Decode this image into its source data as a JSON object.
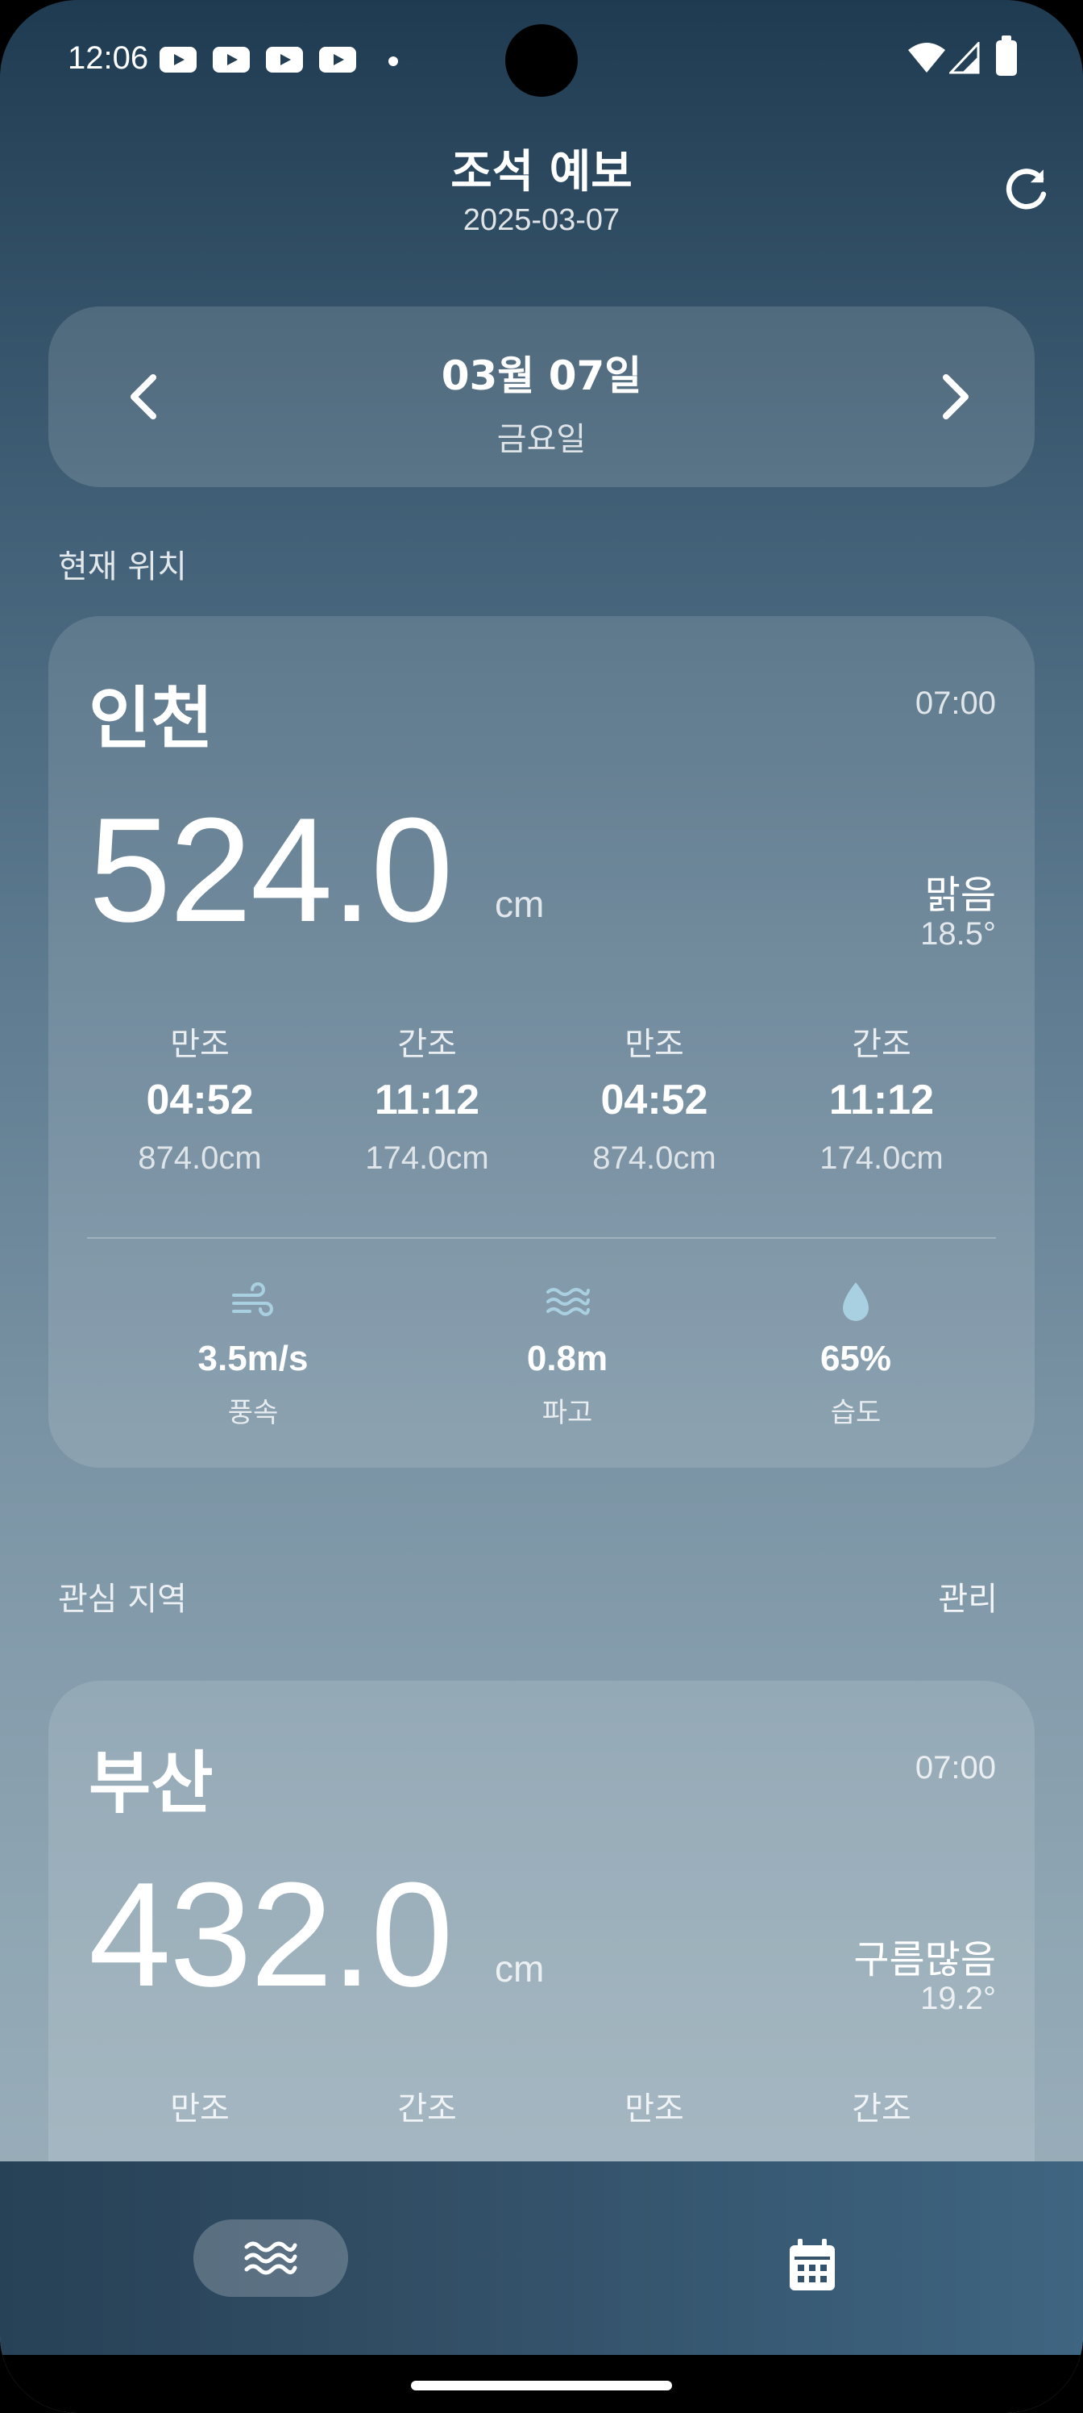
{
  "status_bar": {
    "time": "12:06"
  },
  "header": {
    "title": "조석 예보",
    "date": "2025-03-07"
  },
  "date_selector": {
    "date": "03월 07일",
    "weekday": "금요일"
  },
  "current_section": {
    "label": "현재 위치"
  },
  "favorites_section": {
    "label": "관심 지역",
    "action": "관리"
  },
  "cards": [
    {
      "city": "인천",
      "time": "07:00",
      "level": "524.0",
      "unit": "cm",
      "weather": "맑음",
      "temp": "18.5°",
      "tides": [
        {
          "type": "만조",
          "time": "04:52",
          "height": "874.0cm"
        },
        {
          "type": "간조",
          "time": "11:12",
          "height": "174.0cm"
        },
        {
          "type": "만조",
          "time": "04:52",
          "height": "874.0cm"
        },
        {
          "type": "간조",
          "time": "11:12",
          "height": "174.0cm"
        }
      ],
      "stats": [
        {
          "icon": "wind-icon",
          "value": "3.5m/s",
          "label": "풍속"
        },
        {
          "icon": "wave-icon",
          "value": "0.8m",
          "label": "파고"
        },
        {
          "icon": "humidity-drop-icon",
          "value": "65%",
          "label": "습도"
        }
      ]
    },
    {
      "city": "부산",
      "time": "07:00",
      "level": "432.0",
      "unit": "cm",
      "weather": "구름많음",
      "temp": "19.2°",
      "tides": [
        {
          "type": "만조"
        },
        {
          "type": "간조"
        },
        {
          "type": "만조"
        },
        {
          "type": "간조"
        }
      ]
    }
  ],
  "bottom_nav": {
    "items": [
      {
        "icon": "waves-icon",
        "selected": true
      },
      {
        "icon": "calendar-icon",
        "selected": false
      }
    ]
  },
  "colors": {
    "accent_icon": "#a9d0e0"
  }
}
